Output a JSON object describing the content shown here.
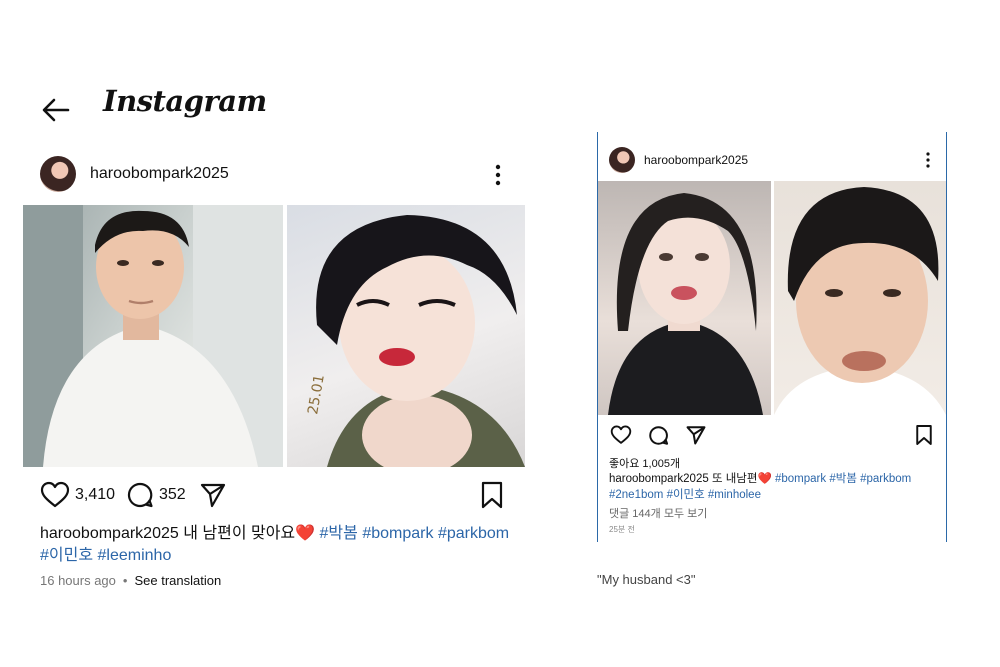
{
  "left_post": {
    "brand": "Instagram",
    "username": "haroobompark2025",
    "likes": "3,410",
    "comments": "352",
    "caption_user": "haroobompark2025",
    "caption_text": " 내 남편이 맞아요",
    "caption_heart": "❤️",
    "hashtags": [
      "#박봄",
      "#bompark",
      "#parkbom",
      "#이민호",
      "#leeminho"
    ],
    "time": "16 hours ago",
    "see_translation": "See translation"
  },
  "right_post": {
    "username": "haroobompark2025",
    "likes": "좋아요 1,005개",
    "caption_user": "haroobompark2025",
    "caption_text": " 또 내남편",
    "caption_heart": "❤️",
    "hashtags": [
      "#bompark",
      "#박봄",
      "#parkbom",
      "#2ne1bom",
      "#이민호",
      "#minholee"
    ],
    "view_comments": "댓글 144개 모두 보기",
    "time": "25분 전"
  },
  "note": "\"My husband <3\"",
  "icons": [
    "back-arrow-icon",
    "more-icon",
    "heart-icon",
    "comment-icon",
    "send-icon",
    "bookmark-icon"
  ],
  "colors": {
    "hashtag": "#2c66a8",
    "heart": "#e0245e",
    "frame_border": "#2b69a8"
  }
}
